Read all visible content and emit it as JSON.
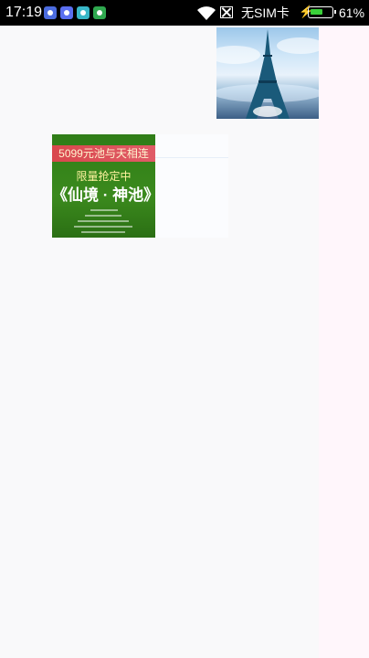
{
  "status_bar": {
    "time": "17:19",
    "carrier": "无SIM卡",
    "battery_percent": "61%",
    "battery_level": 0.61,
    "notification_icons": [
      "media-app-icon",
      "media-app-icon",
      "chat-app-icon",
      "android-app-icon"
    ]
  },
  "colors": {
    "status_bar_bg": "#000000",
    "page_bg": "#f9f9fa",
    "battery_fill": "#3ad13a",
    "poster_bg": "#2f7d17"
  },
  "content": {
    "poster": {
      "banner": "5099元池与天相连",
      "tag": "限量抢定中",
      "title": "《仙境 · 神池》"
    }
  }
}
